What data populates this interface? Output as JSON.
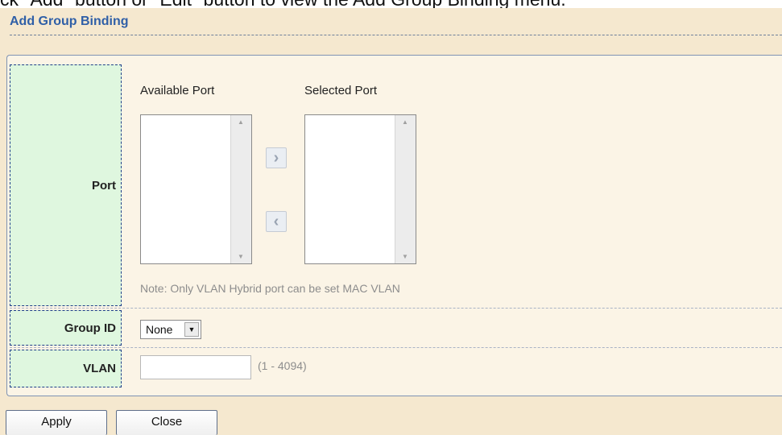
{
  "caption": {
    "text": "ck \"Add\" button or \"Edit\" button to view the Add Group Binding menu."
  },
  "panel": {
    "title": "Add Group Binding"
  },
  "form": {
    "port": {
      "label": "Port",
      "available_label": "Available Port",
      "selected_label": "Selected Port",
      "note": "Note: Only VLAN Hybrid port can be set MAC VLAN"
    },
    "group_id": {
      "label": "Group ID",
      "selected_value": "None"
    },
    "vlan": {
      "label": "VLAN",
      "value": "",
      "range": "(1 - 4094)"
    }
  },
  "buttons": {
    "apply": "Apply",
    "close": "Close"
  },
  "icons": {
    "add": "chevron-right-icon",
    "remove": "chevron-left-icon",
    "dropdown": "triangle-down-icon"
  }
}
